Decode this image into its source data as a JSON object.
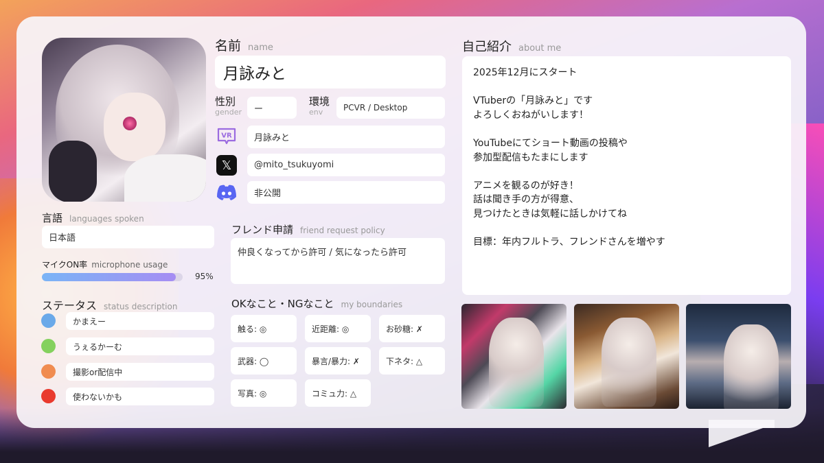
{
  "profile": {
    "name_label": "名前",
    "name_label_en": "name",
    "name": "月詠みと",
    "gender_label": "性別",
    "gender_label_en": "gender",
    "gender": "ー",
    "env_label": "環境",
    "env_label_en": "env",
    "env": "PCVR / Desktop"
  },
  "social": {
    "vrchat": {
      "icon": "vrchat-icon",
      "icon_text": "VR",
      "value": "月詠みと"
    },
    "x": {
      "icon": "x-icon",
      "icon_text": "𝕏",
      "value": "@mito_tsukuyomi"
    },
    "discord": {
      "icon": "discord-icon",
      "value": "非公開"
    }
  },
  "language": {
    "label": "言語",
    "label_en": "languages spoken",
    "value": "日本語"
  },
  "mic": {
    "label": "マイクON率",
    "label_en": "microphone usage",
    "percent_text": "95%",
    "fraction": 0.95
  },
  "status": {
    "label": "ステータス",
    "label_en": "status description",
    "items": [
      {
        "color": "#6aa9e9",
        "text": "かまえー"
      },
      {
        "color": "#84d15e",
        "text": "うぇるかーむ"
      },
      {
        "color": "#f08c50",
        "text": "撮影or配信中"
      },
      {
        "color": "#e93a2e",
        "text": "使わないかも"
      }
    ]
  },
  "friend": {
    "label": "フレンド申請",
    "label_en": "friend request policy",
    "value": "仲良くなってから許可 / 気になったら許可"
  },
  "boundaries": {
    "label": "OKなこと・NGなこと",
    "label_en": "my boundaries",
    "items": [
      "触る: ◎",
      "近距離: ◎",
      "お砂糖: ✗",
      "武器: ◯",
      "暴言/暴力: ✗",
      "下ネタ: △",
      "写真: ◎",
      "コミュ力: △"
    ]
  },
  "about": {
    "label": "自己紹介",
    "label_en": "about me",
    "text": "2025年12月にスタート\n\nVTuberの「月詠みと」です\nよろしくおねがいします！\n\nYouTubeにてショート動画の投稿や\n参加型配信もたまにします\n\nアニメを観るのが好き！\n話は聞き手の方が得意、\n見つけたときは気軽に話しかけてね\n\n目標：年内フルトラ、フレンドさんを増やす"
  },
  "colors": {
    "accent_purple": "#a68df3",
    "accent_blue": "#7ab4f6",
    "discord": "#5865f2",
    "vrchat": "#9b6be0"
  }
}
